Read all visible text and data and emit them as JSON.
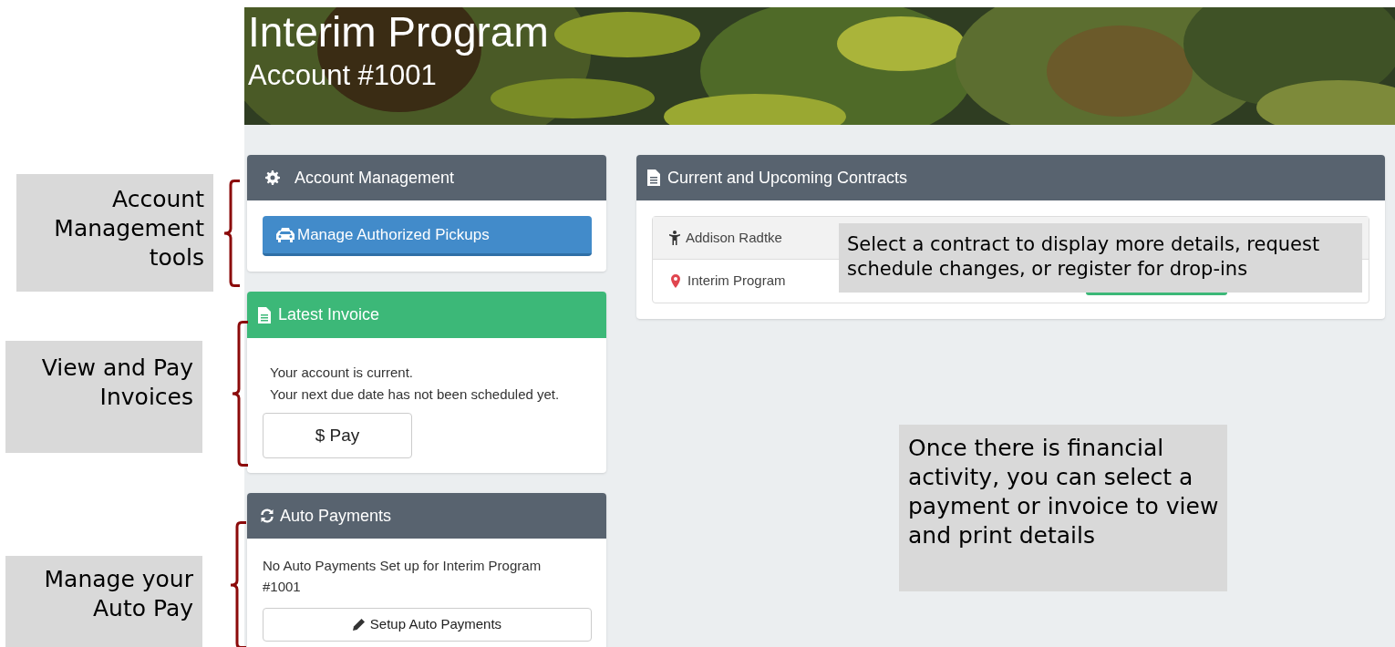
{
  "banner": {
    "title": "Interim Program",
    "subtitle": "Account #1001"
  },
  "account_management": {
    "title": "Account Management",
    "button": "Manage Authorized Pickups"
  },
  "latest_invoice": {
    "title": "Latest Invoice",
    "lines": [
      "Your account is current.",
      "Your next due date has not been scheduled yet."
    ],
    "button": "$ Pay"
  },
  "auto_payments": {
    "title": "Auto Payments",
    "message": "No Auto Payments Set up for Interim Program #1001",
    "button": "Setup Auto Payments"
  },
  "contracts": {
    "title": "Current and Upcoming Contracts",
    "child": "Addison Radtke",
    "program": "Interim Program"
  },
  "annotations": [
    {
      "text": "Account Management tools"
    },
    {
      "text": "View and Pay Invoices"
    },
    {
      "text": "Manage your Auto Pay"
    },
    {
      "text": "Select a contract to display more details, request schedule changes, or register for drop-ins"
    },
    {
      "text": "Once there is financial activity, you can select a payment or invoice to view and print details"
    }
  ]
}
